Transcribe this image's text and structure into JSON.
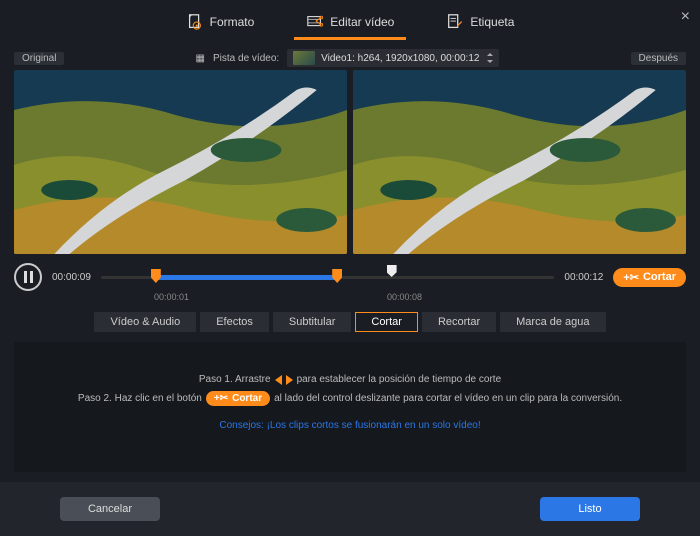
{
  "toptabs": {
    "formato": "Formato",
    "editar": "Editar vídeo",
    "etiqueta": "Etiqueta"
  },
  "labels": {
    "original": "Original",
    "despues": "Después",
    "track": "Pista de vídeo:"
  },
  "track_select": "Video1: h264, 1920x1080, 00:00:12",
  "time": {
    "current": "00:00:09",
    "total": "00:00:12",
    "h1": "00:00:01",
    "h2": "00:00:08"
  },
  "cortar_btn": "Cortar",
  "tabs": {
    "va": "Vídeo & Audio",
    "ef": "Efectos",
    "sub": "Subtitular",
    "cor": "Cortar",
    "rec": "Recortar",
    "wm": "Marca de agua"
  },
  "step1a": "Paso 1. Arrastre",
  "step1b": "para establecer la posición de tiempo de corte",
  "step2a": "Paso 2. Haz clic en el botón",
  "step2b": "al lado del control deslizante para cortar el vídeo en un clip para la conversión.",
  "tip": "Consejos: ¡Los clips cortos se fusionarán en un solo vídeo!",
  "footer": {
    "cancel": "Cancelar",
    "ok": "Listo"
  },
  "colors": {
    "accent": "#ff8c1a",
    "primary": "#2c77e6"
  }
}
